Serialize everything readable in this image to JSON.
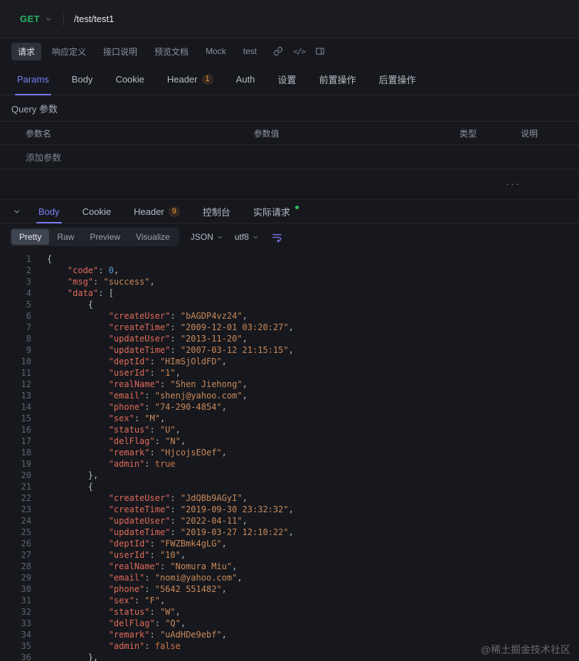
{
  "request_bar": {
    "method": "GET",
    "path": "/test/test1"
  },
  "doc_tabs": [
    "请求",
    "响应定义",
    "接口说明",
    "预览文档",
    "Mock",
    "test"
  ],
  "request_section": {
    "tabs": [
      {
        "label": "Params"
      },
      {
        "label": "Body"
      },
      {
        "label": "Cookie"
      },
      {
        "label": "Header",
        "badge": "1"
      },
      {
        "label": "Auth"
      },
      {
        "label": "设置"
      },
      {
        "label": "前置操作"
      },
      {
        "label": "后置操作"
      }
    ],
    "query_label": "Query 参数",
    "columns": [
      "参数名",
      "参数值",
      "类型",
      "说明"
    ],
    "add_row_label": "添加参数"
  },
  "splitter_dots": "···",
  "response_section": {
    "tabs": [
      {
        "label": "Body"
      },
      {
        "label": "Cookie"
      },
      {
        "label": "Header",
        "badge": "9"
      },
      {
        "label": "控制台"
      },
      {
        "label": "实际请求"
      }
    ],
    "view_modes": [
      "Pretty",
      "Raw",
      "Preview",
      "Visualize"
    ],
    "active_view": "Pretty",
    "format_select": "JSON",
    "encoding_select": "utf8"
  },
  "colors": {
    "accent_purple": "#7b7df7",
    "method_green": "#27b562",
    "badge_orange": "#ef9c3c",
    "success_dot_green": "#2fc25b"
  },
  "editor": {
    "lines": [
      [
        [
          "p",
          "{"
        ]
      ],
      [
        [
          "p",
          "    "
        ],
        [
          "k",
          "\"code\""
        ],
        [
          "p",
          ": "
        ],
        [
          "n",
          "0"
        ],
        [
          "p",
          ","
        ]
      ],
      [
        [
          "p",
          "    "
        ],
        [
          "k",
          "\"msg\""
        ],
        [
          "p",
          ": "
        ],
        [
          "s",
          "\"success\""
        ],
        [
          "p",
          ","
        ]
      ],
      [
        [
          "p",
          "    "
        ],
        [
          "k",
          "\"data\""
        ],
        [
          "p",
          ": ["
        ]
      ],
      [
        [
          "p",
          "        {"
        ]
      ],
      [
        [
          "p",
          "            "
        ],
        [
          "k",
          "\"createUser\""
        ],
        [
          "p",
          ": "
        ],
        [
          "s",
          "\"bAGDP4vz24\""
        ],
        [
          "p",
          ","
        ]
      ],
      [
        [
          "p",
          "            "
        ],
        [
          "k",
          "\"createTime\""
        ],
        [
          "p",
          ": "
        ],
        [
          "s",
          "\"2009-12-01 03:20:27\""
        ],
        [
          "p",
          ","
        ]
      ],
      [
        [
          "p",
          "            "
        ],
        [
          "k",
          "\"updateUser\""
        ],
        [
          "p",
          ": "
        ],
        [
          "s",
          "\"2013-11-20\""
        ],
        [
          "p",
          ","
        ]
      ],
      [
        [
          "p",
          "            "
        ],
        [
          "k",
          "\"updateTime\""
        ],
        [
          "p",
          ": "
        ],
        [
          "s",
          "\"2007-03-12 21:15:15\""
        ],
        [
          "p",
          ","
        ]
      ],
      [
        [
          "p",
          "            "
        ],
        [
          "k",
          "\"deptId\""
        ],
        [
          "p",
          ": "
        ],
        [
          "s",
          "\"HImSjOldFD\""
        ],
        [
          "p",
          ","
        ]
      ],
      [
        [
          "p",
          "            "
        ],
        [
          "k",
          "\"userId\""
        ],
        [
          "p",
          ": "
        ],
        [
          "s",
          "\"1\""
        ],
        [
          "p",
          ","
        ]
      ],
      [
        [
          "p",
          "            "
        ],
        [
          "k",
          "\"realName\""
        ],
        [
          "p",
          ": "
        ],
        [
          "s",
          "\"Shen Jiehong\""
        ],
        [
          "p",
          ","
        ]
      ],
      [
        [
          "p",
          "            "
        ],
        [
          "k",
          "\"email\""
        ],
        [
          "p",
          ": "
        ],
        [
          "s",
          "\"shenj@yahoo.com\""
        ],
        [
          "p",
          ","
        ]
      ],
      [
        [
          "p",
          "            "
        ],
        [
          "k",
          "\"phone\""
        ],
        [
          "p",
          ": "
        ],
        [
          "s",
          "\"74-290-4854\""
        ],
        [
          "p",
          ","
        ]
      ],
      [
        [
          "p",
          "            "
        ],
        [
          "k",
          "\"sex\""
        ],
        [
          "p",
          ": "
        ],
        [
          "s",
          "\"M\""
        ],
        [
          "p",
          ","
        ]
      ],
      [
        [
          "p",
          "            "
        ],
        [
          "k",
          "\"status\""
        ],
        [
          "p",
          ": "
        ],
        [
          "s",
          "\"U\""
        ],
        [
          "p",
          ","
        ]
      ],
      [
        [
          "p",
          "            "
        ],
        [
          "k",
          "\"delFlag\""
        ],
        [
          "p",
          ": "
        ],
        [
          "s",
          "\"N\""
        ],
        [
          "p",
          ","
        ]
      ],
      [
        [
          "p",
          "            "
        ],
        [
          "k",
          "\"remark\""
        ],
        [
          "p",
          ": "
        ],
        [
          "s",
          "\"HjcojsEOef\""
        ],
        [
          "p",
          ","
        ]
      ],
      [
        [
          "p",
          "            "
        ],
        [
          "k",
          "\"admin\""
        ],
        [
          "p",
          ": "
        ],
        [
          "b",
          "true"
        ]
      ],
      [
        [
          "p",
          "        },"
        ]
      ],
      [
        [
          "p",
          "        {"
        ]
      ],
      [
        [
          "p",
          "            "
        ],
        [
          "k",
          "\"createUser\""
        ],
        [
          "p",
          ": "
        ],
        [
          "s",
          "\"JdQBb9AGyI\""
        ],
        [
          "p",
          ","
        ]
      ],
      [
        [
          "p",
          "            "
        ],
        [
          "k",
          "\"createTime\""
        ],
        [
          "p",
          ": "
        ],
        [
          "s",
          "\"2019-09-30 23:32:32\""
        ],
        [
          "p",
          ","
        ]
      ],
      [
        [
          "p",
          "            "
        ],
        [
          "k",
          "\"updateUser\""
        ],
        [
          "p",
          ": "
        ],
        [
          "s",
          "\"2022-04-11\""
        ],
        [
          "p",
          ","
        ]
      ],
      [
        [
          "p",
          "            "
        ],
        [
          "k",
          "\"updateTime\""
        ],
        [
          "p",
          ": "
        ],
        [
          "s",
          "\"2019-03-27 12:10:22\""
        ],
        [
          "p",
          ","
        ]
      ],
      [
        [
          "p",
          "            "
        ],
        [
          "k",
          "\"deptId\""
        ],
        [
          "p",
          ": "
        ],
        [
          "s",
          "\"FWZBmk4gLG\""
        ],
        [
          "p",
          ","
        ]
      ],
      [
        [
          "p",
          "            "
        ],
        [
          "k",
          "\"userId\""
        ],
        [
          "p",
          ": "
        ],
        [
          "s",
          "\"10\""
        ],
        [
          "p",
          ","
        ]
      ],
      [
        [
          "p",
          "            "
        ],
        [
          "k",
          "\"realName\""
        ],
        [
          "p",
          ": "
        ],
        [
          "s",
          "\"Nomura Miu\""
        ],
        [
          "p",
          ","
        ]
      ],
      [
        [
          "p",
          "            "
        ],
        [
          "k",
          "\"email\""
        ],
        [
          "p",
          ": "
        ],
        [
          "s",
          "\"nomi@yahoo.com\""
        ],
        [
          "p",
          ","
        ]
      ],
      [
        [
          "p",
          "            "
        ],
        [
          "k",
          "\"phone\""
        ],
        [
          "p",
          ": "
        ],
        [
          "s",
          "\"5642 551482\""
        ],
        [
          "p",
          ","
        ]
      ],
      [
        [
          "p",
          "            "
        ],
        [
          "k",
          "\"sex\""
        ],
        [
          "p",
          ": "
        ],
        [
          "s",
          "\"F\""
        ],
        [
          "p",
          ","
        ]
      ],
      [
        [
          "p",
          "            "
        ],
        [
          "k",
          "\"status\""
        ],
        [
          "p",
          ": "
        ],
        [
          "s",
          "\"W\""
        ],
        [
          "p",
          ","
        ]
      ],
      [
        [
          "p",
          "            "
        ],
        [
          "k",
          "\"delFlag\""
        ],
        [
          "p",
          ": "
        ],
        [
          "s",
          "\"Q\""
        ],
        [
          "p",
          ","
        ]
      ],
      [
        [
          "p",
          "            "
        ],
        [
          "k",
          "\"remark\""
        ],
        [
          "p",
          ": "
        ],
        [
          "s",
          "\"uAdHDe9ebf\""
        ],
        [
          "p",
          ","
        ]
      ],
      [
        [
          "p",
          "            "
        ],
        [
          "k",
          "\"admin\""
        ],
        [
          "p",
          ": "
        ],
        [
          "b",
          "false"
        ]
      ],
      [
        [
          "p",
          "        },"
        ]
      ]
    ]
  },
  "watermark": "@稀土掘金技术社区"
}
